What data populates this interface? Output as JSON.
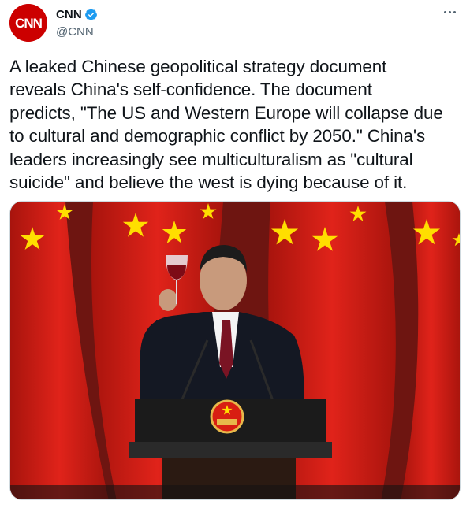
{
  "author": {
    "name": "CNN",
    "handle": "@CNN",
    "avatar_text": "CNN",
    "avatar_color": "#cc0000",
    "verified": true,
    "verified_color": "#1d9bf0"
  },
  "tweet": {
    "text": "A leaked Chinese geopolitical strategy document\nreveals China's self-confidence. The document\npredicts, \"The US and Western Europe will collapse due\nto cultural and demographic conflict by 2050.\" China's\nleaders increasingly see multiculturalism as \"cultural\nsuicide\" and believe the west is dying because of it."
  },
  "media": {
    "icon": "photo-icon",
    "colors": {
      "flag_red": "#d81e12",
      "star_yellow": "#ffde00",
      "backdrop": "#7a1a14",
      "podium": "#1b1b1b"
    }
  },
  "icons": [
    "verified-badge-icon",
    "more-options-icon"
  ]
}
